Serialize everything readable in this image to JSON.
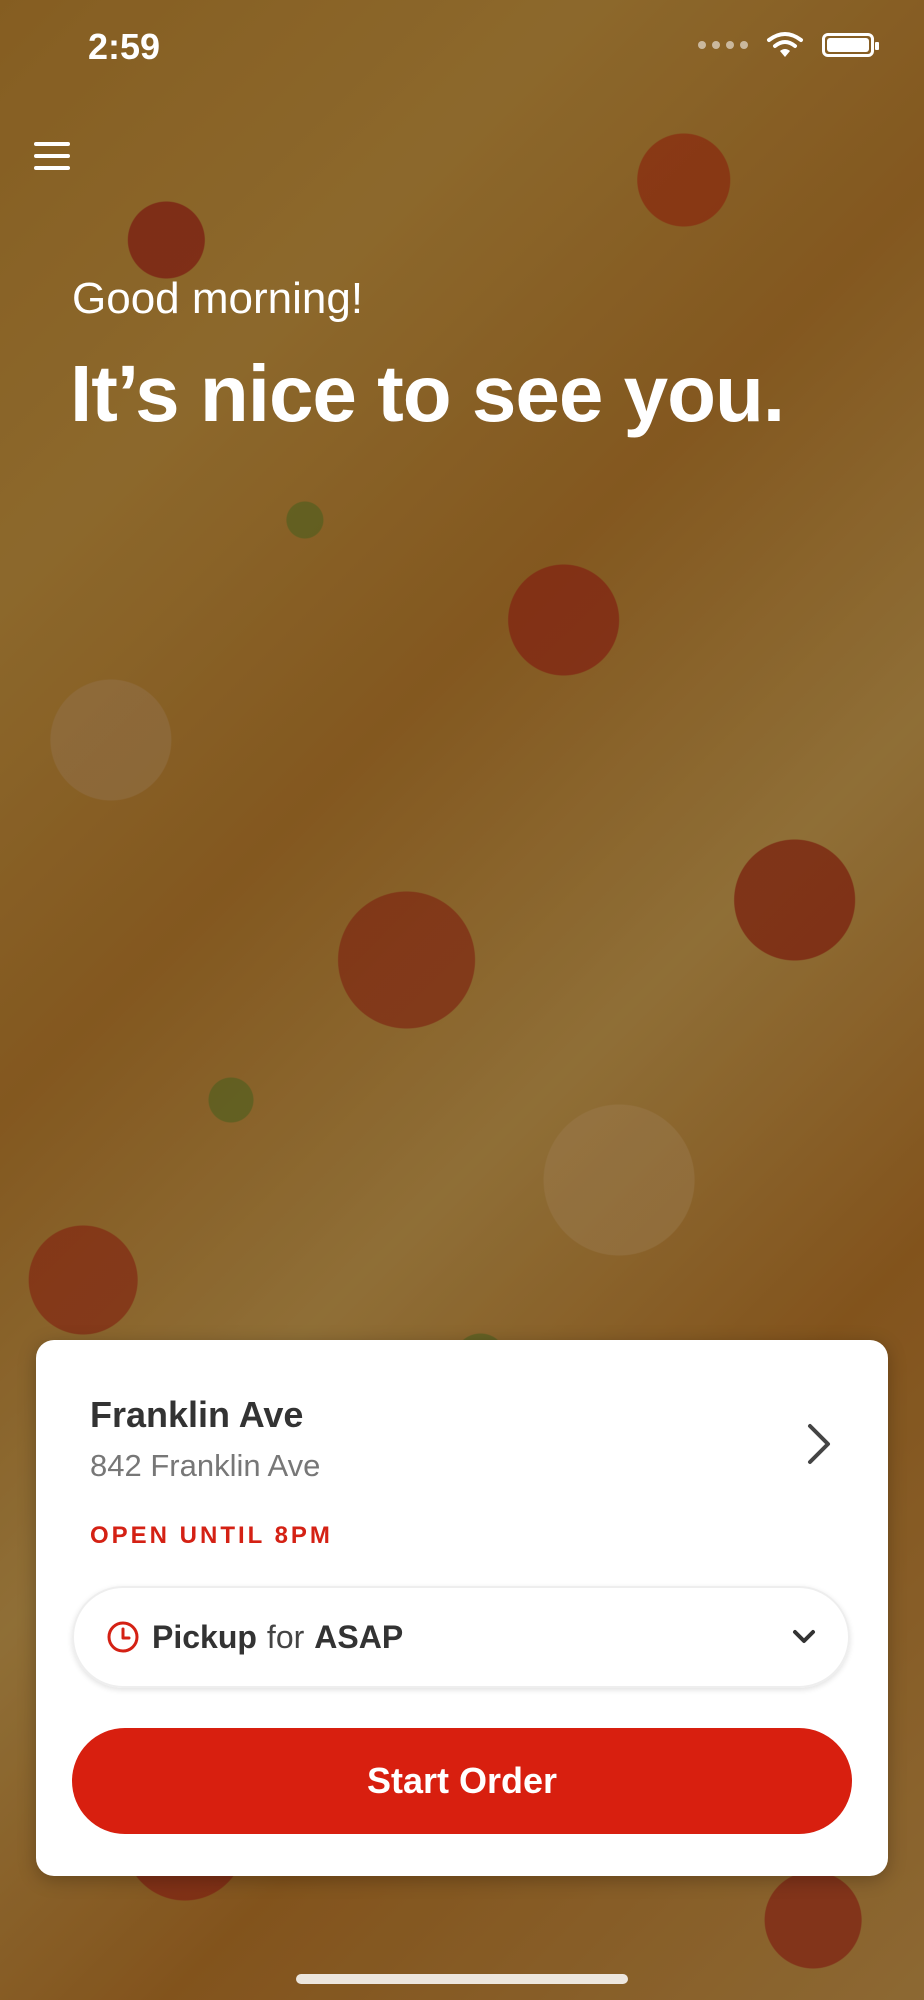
{
  "status_bar": {
    "time": "2:59"
  },
  "icons": {
    "menu": "menu-icon",
    "wifi": "wifi-icon",
    "battery": "battery-icon",
    "clock": "clock-icon",
    "chevron_right": "chevron-right-icon",
    "chevron_down": "chevron-down-icon"
  },
  "greeting": {
    "salutation": "Good morning!",
    "headline": "It’s nice to see you."
  },
  "store": {
    "name": "Franklin Ave",
    "address": "842 Franklin Ave",
    "hours": "OPEN UNTIL 8PM"
  },
  "order_options": {
    "mode": "Pickup",
    "connector": "for",
    "time": "ASAP"
  },
  "actions": {
    "start_order": "Start Order"
  },
  "colors": {
    "accent": "#d81f0f",
    "status_text": "#d42114",
    "card_background": "#ffffff"
  }
}
